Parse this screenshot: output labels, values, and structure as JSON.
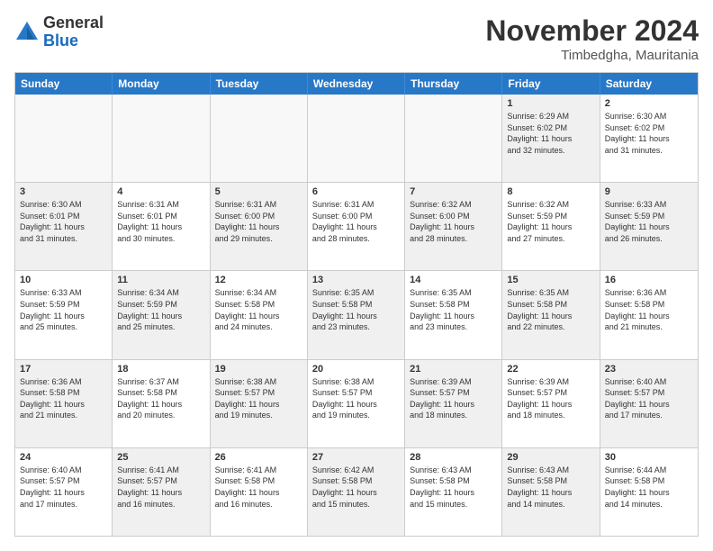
{
  "logo": {
    "general": "General",
    "blue": "Blue"
  },
  "title": "November 2024",
  "location": "Timbedgha, Mauritania",
  "header": {
    "days": [
      "Sunday",
      "Monday",
      "Tuesday",
      "Wednesday",
      "Thursday",
      "Friday",
      "Saturday"
    ]
  },
  "rows": [
    [
      {
        "day": "",
        "info": "",
        "empty": true
      },
      {
        "day": "",
        "info": "",
        "empty": true
      },
      {
        "day": "",
        "info": "",
        "empty": true
      },
      {
        "day": "",
        "info": "",
        "empty": true
      },
      {
        "day": "",
        "info": "",
        "empty": true
      },
      {
        "day": "1",
        "info": "Sunrise: 6:29 AM\nSunset: 6:02 PM\nDaylight: 11 hours\nand 32 minutes.",
        "shaded": true
      },
      {
        "day": "2",
        "info": "Sunrise: 6:30 AM\nSunset: 6:02 PM\nDaylight: 11 hours\nand 31 minutes.",
        "shaded": false
      }
    ],
    [
      {
        "day": "3",
        "info": "Sunrise: 6:30 AM\nSunset: 6:01 PM\nDaylight: 11 hours\nand 31 minutes.",
        "shaded": true
      },
      {
        "day": "4",
        "info": "Sunrise: 6:31 AM\nSunset: 6:01 PM\nDaylight: 11 hours\nand 30 minutes.",
        "shaded": false
      },
      {
        "day": "5",
        "info": "Sunrise: 6:31 AM\nSunset: 6:00 PM\nDaylight: 11 hours\nand 29 minutes.",
        "shaded": true
      },
      {
        "day": "6",
        "info": "Sunrise: 6:31 AM\nSunset: 6:00 PM\nDaylight: 11 hours\nand 28 minutes.",
        "shaded": false
      },
      {
        "day": "7",
        "info": "Sunrise: 6:32 AM\nSunset: 6:00 PM\nDaylight: 11 hours\nand 28 minutes.",
        "shaded": true
      },
      {
        "day": "8",
        "info": "Sunrise: 6:32 AM\nSunset: 5:59 PM\nDaylight: 11 hours\nand 27 minutes.",
        "shaded": false
      },
      {
        "day": "9",
        "info": "Sunrise: 6:33 AM\nSunset: 5:59 PM\nDaylight: 11 hours\nand 26 minutes.",
        "shaded": true
      }
    ],
    [
      {
        "day": "10",
        "info": "Sunrise: 6:33 AM\nSunset: 5:59 PM\nDaylight: 11 hours\nand 25 minutes.",
        "shaded": false
      },
      {
        "day": "11",
        "info": "Sunrise: 6:34 AM\nSunset: 5:59 PM\nDaylight: 11 hours\nand 25 minutes.",
        "shaded": true
      },
      {
        "day": "12",
        "info": "Sunrise: 6:34 AM\nSunset: 5:58 PM\nDaylight: 11 hours\nand 24 minutes.",
        "shaded": false
      },
      {
        "day": "13",
        "info": "Sunrise: 6:35 AM\nSunset: 5:58 PM\nDaylight: 11 hours\nand 23 minutes.",
        "shaded": true
      },
      {
        "day": "14",
        "info": "Sunrise: 6:35 AM\nSunset: 5:58 PM\nDaylight: 11 hours\nand 23 minutes.",
        "shaded": false
      },
      {
        "day": "15",
        "info": "Sunrise: 6:35 AM\nSunset: 5:58 PM\nDaylight: 11 hours\nand 22 minutes.",
        "shaded": true
      },
      {
        "day": "16",
        "info": "Sunrise: 6:36 AM\nSunset: 5:58 PM\nDaylight: 11 hours\nand 21 minutes.",
        "shaded": false
      }
    ],
    [
      {
        "day": "17",
        "info": "Sunrise: 6:36 AM\nSunset: 5:58 PM\nDaylight: 11 hours\nand 21 minutes.",
        "shaded": true
      },
      {
        "day": "18",
        "info": "Sunrise: 6:37 AM\nSunset: 5:58 PM\nDaylight: 11 hours\nand 20 minutes.",
        "shaded": false
      },
      {
        "day": "19",
        "info": "Sunrise: 6:38 AM\nSunset: 5:57 PM\nDaylight: 11 hours\nand 19 minutes.",
        "shaded": true
      },
      {
        "day": "20",
        "info": "Sunrise: 6:38 AM\nSunset: 5:57 PM\nDaylight: 11 hours\nand 19 minutes.",
        "shaded": false
      },
      {
        "day": "21",
        "info": "Sunrise: 6:39 AM\nSunset: 5:57 PM\nDaylight: 11 hours\nand 18 minutes.",
        "shaded": true
      },
      {
        "day": "22",
        "info": "Sunrise: 6:39 AM\nSunset: 5:57 PM\nDaylight: 11 hours\nand 18 minutes.",
        "shaded": false
      },
      {
        "day": "23",
        "info": "Sunrise: 6:40 AM\nSunset: 5:57 PM\nDaylight: 11 hours\nand 17 minutes.",
        "shaded": true
      }
    ],
    [
      {
        "day": "24",
        "info": "Sunrise: 6:40 AM\nSunset: 5:57 PM\nDaylight: 11 hours\nand 17 minutes.",
        "shaded": false
      },
      {
        "day": "25",
        "info": "Sunrise: 6:41 AM\nSunset: 5:57 PM\nDaylight: 11 hours\nand 16 minutes.",
        "shaded": true
      },
      {
        "day": "26",
        "info": "Sunrise: 6:41 AM\nSunset: 5:58 PM\nDaylight: 11 hours\nand 16 minutes.",
        "shaded": false
      },
      {
        "day": "27",
        "info": "Sunrise: 6:42 AM\nSunset: 5:58 PM\nDaylight: 11 hours\nand 15 minutes.",
        "shaded": true
      },
      {
        "day": "28",
        "info": "Sunrise: 6:43 AM\nSunset: 5:58 PM\nDaylight: 11 hours\nand 15 minutes.",
        "shaded": false
      },
      {
        "day": "29",
        "info": "Sunrise: 6:43 AM\nSunset: 5:58 PM\nDaylight: 11 hours\nand 14 minutes.",
        "shaded": true
      },
      {
        "day": "30",
        "info": "Sunrise: 6:44 AM\nSunset: 5:58 PM\nDaylight: 11 hours\nand 14 minutes.",
        "shaded": false
      }
    ]
  ]
}
